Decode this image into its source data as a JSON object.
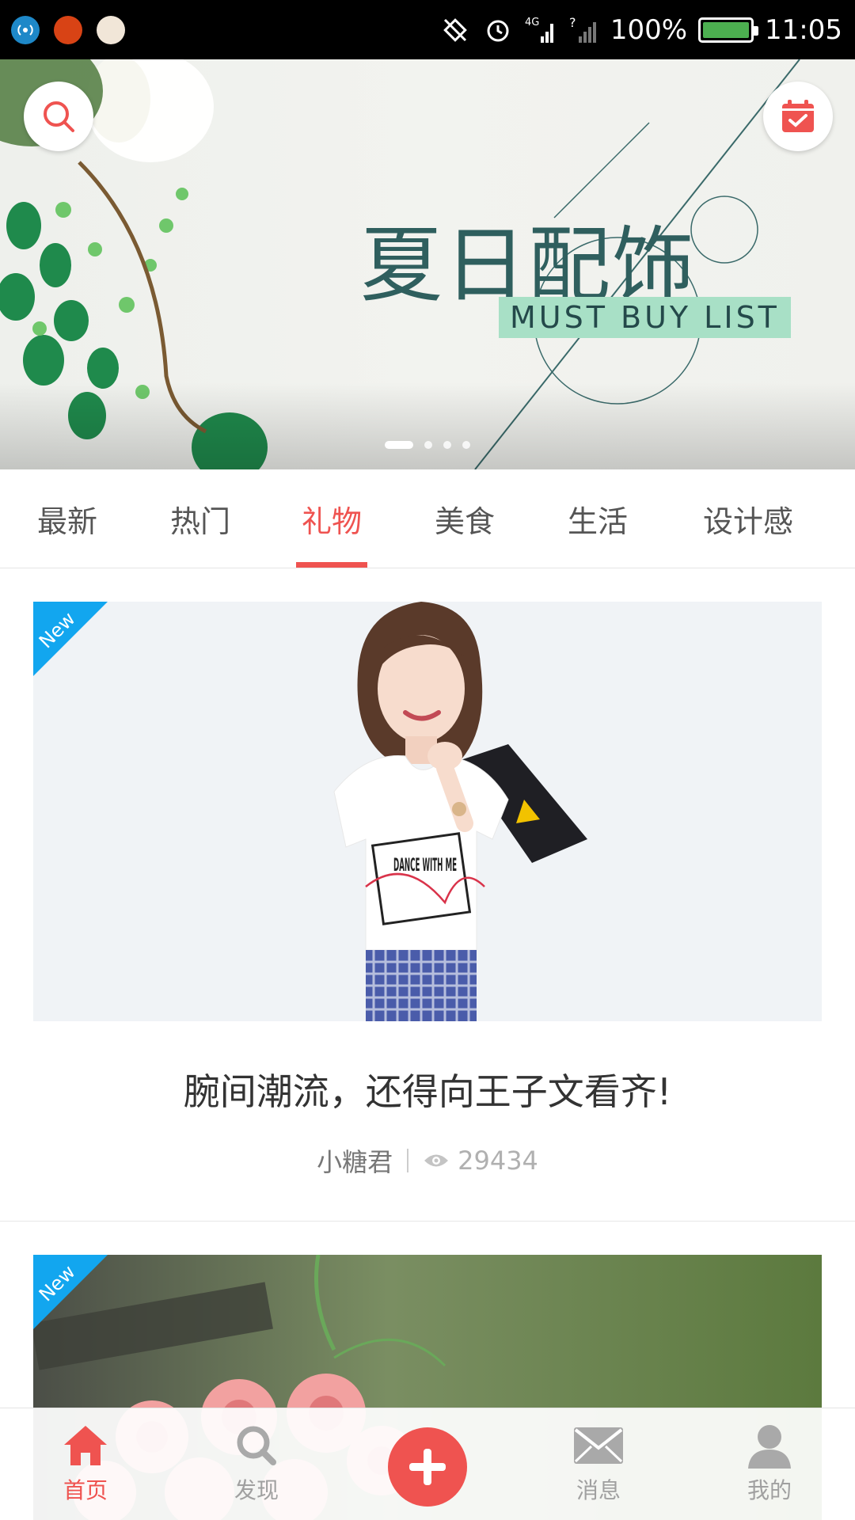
{
  "status_bar": {
    "battery_percent": "100%",
    "time": "11:05",
    "network": "4G",
    "app_icons": [
      "wifi-hotspot-icon",
      "app-badge-icon",
      "app-badge-icon-2"
    ]
  },
  "banner": {
    "title": "夏日配饰",
    "subtitle": "MUST BUY LIST",
    "slide_count": 4,
    "active_slide": 1
  },
  "tabs": [
    {
      "label": "最新",
      "active": false
    },
    {
      "label": "热门",
      "active": false
    },
    {
      "label": "礼物",
      "active": true
    },
    {
      "label": "美食",
      "active": false
    },
    {
      "label": "生活",
      "active": false
    },
    {
      "label": "设计感",
      "active": false
    }
  ],
  "cards": [
    {
      "badge": "New",
      "title": "腕间潮流，还得向王子文看齐!",
      "author": "小糖君",
      "views": "29434",
      "shirt_text": "DANCE WITH ME"
    },
    {
      "badge": "New"
    }
  ],
  "bottom_nav": [
    {
      "label": "首页",
      "icon": "home-icon",
      "active": true
    },
    {
      "label": "发现",
      "icon": "search-icon",
      "active": false
    },
    {
      "label": "",
      "icon": "plus-icon",
      "active": false
    },
    {
      "label": "消息",
      "icon": "mail-icon",
      "active": false
    },
    {
      "label": "我的",
      "icon": "person-icon",
      "active": false
    }
  ],
  "colors": {
    "accent": "#ef5350",
    "badge": "#12a6ef",
    "status_bar": "#000000"
  }
}
